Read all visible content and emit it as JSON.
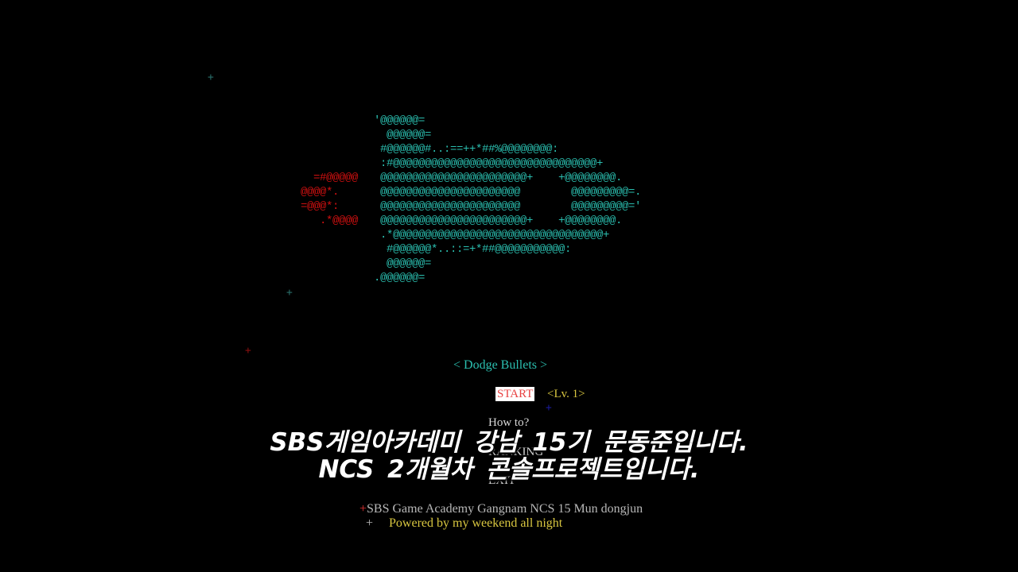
{
  "colors": {
    "background": "#000000",
    "art_cyan": "#2bbfb0",
    "art_red": "#d01010",
    "title": "#2bbfb0",
    "start_selected_text": "#e84040",
    "start_selected_bg": "#ffffff",
    "level": "#d8c640",
    "menu_item": "#d8d8d8",
    "credit_gray": "#b8b8b8",
    "credit_yellow": "#d8c640"
  },
  "ascii_art": {
    "exhaust": "\n\n\n\n  =#@@@@@\n@@@@*.\n=@@@*:\n   .*@@@@",
    "ship": "'@@@@@@=\n  @@@@@@=\n #@@@@@@#..:==++*##%@@@@@@@@:\n :#@@@@@@@@@@@@@@@@@@@@@@@@@@@@@@@@+\n @@@@@@@@@@@@@@@@@@@@@@@+    +@@@@@@@@.\n @@@@@@@@@@@@@@@@@@@@@@        @@@@@@@@@=.\n @@@@@@@@@@@@@@@@@@@@@@        @@@@@@@@@='\n @@@@@@@@@@@@@@@@@@@@@@@+    +@@@@@@@@.\n .*@@@@@@@@@@@@@@@@@@@@@@@@@@@@@@@@@+\n  #@@@@@@*..::=+*##@@@@@@@@@@@:\n  @@@@@@=\n.@@@@@@="
  },
  "stars": [
    {
      "glyph": "+",
      "color": "#2a6e6a"
    },
    {
      "glyph": "+",
      "color": "#2a6e6a"
    },
    {
      "glyph": "+",
      "color": "#8a1010"
    },
    {
      "glyph": "+",
      "color": "#1a1a9a"
    }
  ],
  "menu": {
    "title": "< Dodge Bullets >",
    "start_label": "START",
    "level_label": "<Lv. 1>",
    "howto_label": "How to?",
    "ranking_label": "RANKING",
    "exit_label": "EXIT"
  },
  "credits": {
    "line1_prefix": "+",
    "line1_text": "SBS Game Academy Gangnam NCS 15 Mun dongjun",
    "line2_prefix": "+",
    "line2_text": "     Powered by my weekend all night"
  },
  "subtitles": {
    "line1": "SBS게임아카데미 강남 15기 문동준입니다.",
    "line2": "NCS 2개월차 콘솔프로젝트입니다."
  }
}
